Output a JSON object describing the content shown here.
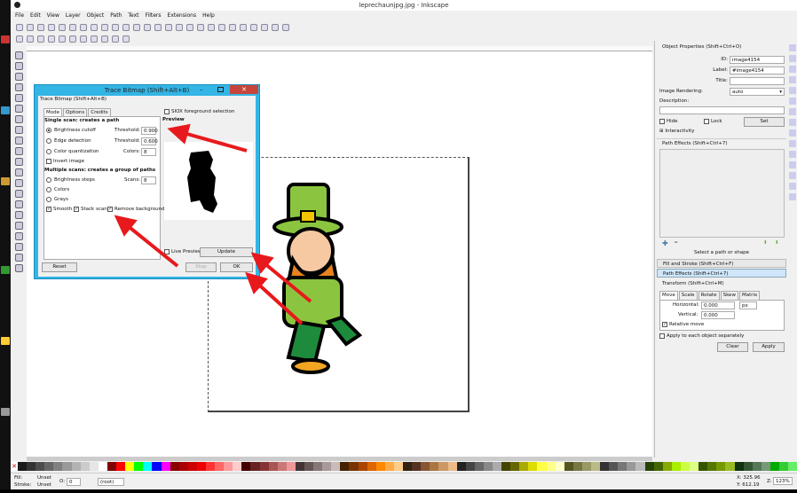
{
  "window": {
    "title": "leprechaunjpg.jpg - Inkscape"
  },
  "menu": [
    "File",
    "Edit",
    "View",
    "Layer",
    "Object",
    "Path",
    "Text",
    "Filters",
    "Extensions",
    "Help"
  ],
  "trace_dialog": {
    "window_title": "Trace Bitmap (Shift+Alt+B)",
    "panel_title": "Trace Bitmap (Shift+Alt+B)",
    "tabs": [
      "Mode",
      "Options",
      "Credits"
    ],
    "single_scan_heading": "Single scan: creates a path",
    "brightness_cutoff": "Brightness cutoff",
    "edge_detection": "Edge detection",
    "color_quantization": "Color quantization",
    "threshold_label": "Threshold:",
    "brightness_threshold": "0.900",
    "edge_threshold": "0.600",
    "colors_label": "Colors:",
    "colors_value": "8",
    "invert_image": "Invert image",
    "multiple_scan_heading": "Multiple scans: creates a group of paths",
    "brightness_steps": "Brightness steps",
    "scans_label": "Scans:",
    "scans_value": "8",
    "colors": "Colors",
    "grays": "Grays",
    "smooth": "Smooth",
    "stack_scans": "Stack scans",
    "remove_background": "Remove background",
    "siox": "SIOX foreground selection",
    "preview": "Preview",
    "live_preview": "Live Preview",
    "update": "Update",
    "reset": "Reset",
    "stop": "Stop",
    "ok": "OK"
  },
  "object_properties": {
    "title": "Object Properties (Shift+Ctrl+O)",
    "id_label": "ID:",
    "id_value": "image4154",
    "label_label": "Label:",
    "label_value": "#image4154",
    "title_label": "Title:",
    "title_value": "",
    "rendering_label": "Image Rendering:",
    "rendering_value": "auto",
    "description_label": "Description:",
    "hide": "Hide",
    "lock": "Lock",
    "set": "Set",
    "interactivity": "Interactivity"
  },
  "path_effects": {
    "title": "Path Effects  (Shift+Ctrl+7)",
    "hint": "Select a path or shape"
  },
  "collapsed": [
    "Fill and Stroke (Shift+Ctrl+F)",
    "Path Effects  (Shift+Ctrl+7)"
  ],
  "transform": {
    "title": "Transform (Shift+Ctrl+M)",
    "tabs": [
      "Move",
      "Scale",
      "Rotate",
      "Skew",
      "Matrix"
    ],
    "horizontal_label": "Horizontal:",
    "horizontal_value": "0.000",
    "vertical_label": "Vertical:",
    "vertical_value": "0.000",
    "unit": "px",
    "relative_move": "Relative move",
    "apply_each": "Apply to each object separately",
    "clear": "Clear",
    "apply": "Apply"
  },
  "status": {
    "fill_label": "Fill:",
    "fill_value": "Unset",
    "stroke_label": "Stroke:",
    "stroke_value": "Unset",
    "opacity_label": "O:",
    "opacity_value": "0",
    "layer": "(root)",
    "x": "X: 325.96",
    "y": "Y: 612.19",
    "zoom_label": "Z:",
    "zoom": "123%"
  },
  "palette": [
    "#1a1a1a",
    "#333",
    "#4d4d4d",
    "#666",
    "#808080",
    "#999",
    "#b3b3b3",
    "#ccc",
    "#e6e6e6",
    "#fff",
    "#800000",
    "#f00",
    "#ff0",
    "#0f0",
    "#0ff",
    "#00f",
    "#f0f",
    "#800",
    "#a00",
    "#c00",
    "#e00",
    "#f33",
    "#f66",
    "#f99",
    "#fcc",
    "#400",
    "#622",
    "#833",
    "#a55",
    "#c77",
    "#e99",
    "#433",
    "#655",
    "#877",
    "#a99",
    "#cbb",
    "#420",
    "#730",
    "#a40",
    "#d60",
    "#f80",
    "#fa4",
    "#fc8",
    "#321",
    "#532",
    "#853",
    "#a74",
    "#c96",
    "#eb8",
    "#222",
    "#444",
    "#666",
    "#888",
    "#aaa",
    "#440",
    "#660",
    "#aa0",
    "#dd0",
    "#ff4",
    "#ff8",
    "#ffc",
    "#552",
    "#774",
    "#996",
    "#bb8",
    "#333",
    "#555",
    "#777",
    "#999",
    "#bbb",
    "#240",
    "#460",
    "#8a0",
    "#ae0",
    "#cf4",
    "#df8",
    "#350",
    "#570",
    "#790",
    "#9b2",
    "#131",
    "#353",
    "#575",
    "#797",
    "#0a0",
    "#3c3",
    "#6e6"
  ]
}
